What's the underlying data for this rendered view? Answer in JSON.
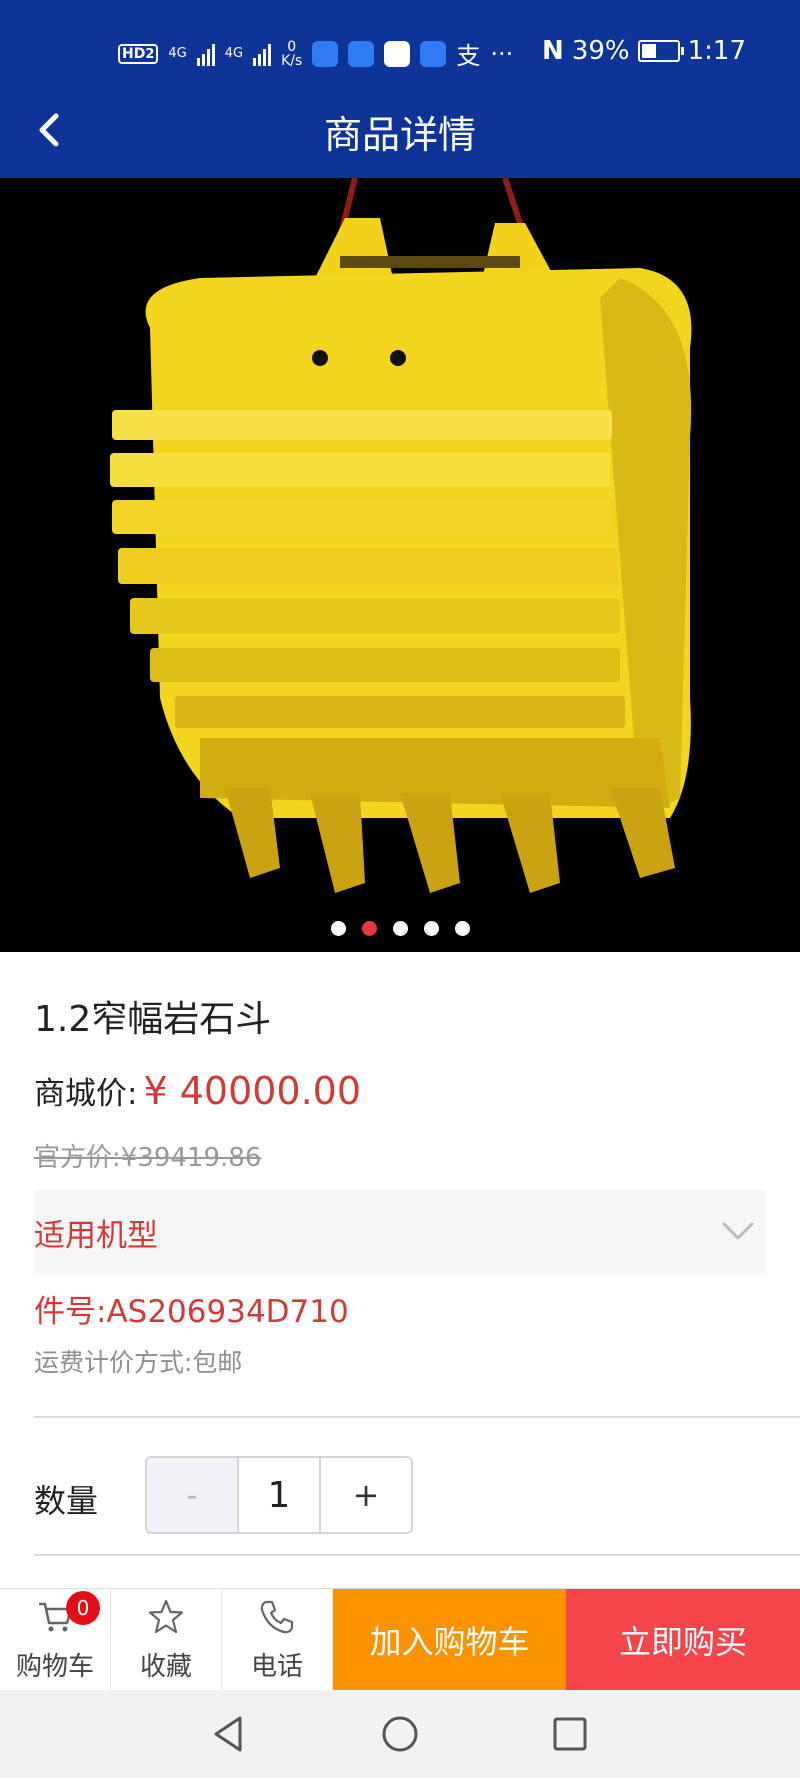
{
  "status_bar": {
    "hd_label": "HD",
    "sim_label": "2",
    "network_1": "4G",
    "network_2": "4G",
    "speed_value": "0",
    "speed_unit": "K/s",
    "notif_text": "支",
    "more": "···",
    "battery_percent": "39%",
    "time": "1:17"
  },
  "header": {
    "title": "商品详情"
  },
  "gallery": {
    "image_alt": "yellow excavator rock bucket",
    "slide_count": 5,
    "active_index": 1
  },
  "product": {
    "name": "1.2窄幅岩石斗",
    "price_label": "商城价:",
    "price_value": "¥ 40000.00",
    "official_price_text": "官方价:¥39419.86",
    "model_label": "适用机型",
    "part_label": "件号:",
    "part_value": "AS206934D710",
    "shipping_text": "运费计价方式:包邮"
  },
  "quantity": {
    "label": "数量",
    "minus": "-",
    "value": "1",
    "plus": "+"
  },
  "bottom_bar": {
    "cart_label": "购物车",
    "cart_badge": "0",
    "favorite_label": "收藏",
    "phone_label": "电话",
    "add_to_cart": "加入购物车",
    "buy_now": "立即购买"
  },
  "colors": {
    "header_bg": "#0d3496",
    "accent_red": "#d03b37",
    "add_cart_bg": "#fb9300",
    "buy_now_bg": "#f4454b"
  }
}
